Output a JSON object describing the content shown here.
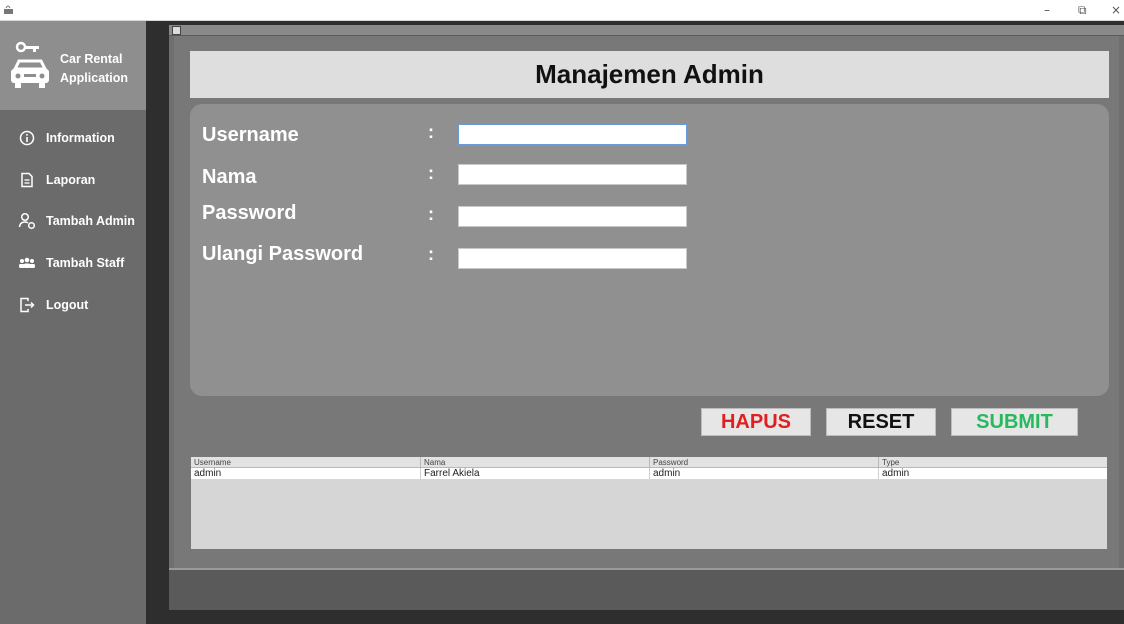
{
  "window": {
    "controls": [
      "–",
      "⧉",
      "×"
    ]
  },
  "sidebar": {
    "brand": {
      "line1": "Car Rental",
      "line2": "Application",
      "icon": "car-key-icon"
    },
    "items": [
      {
        "label": "Information",
        "icon": "info-icon"
      },
      {
        "label": "Laporan",
        "icon": "document-icon"
      },
      {
        "label": "Tambah Admin",
        "icon": "user-settings-icon"
      },
      {
        "label": "Tambah Staff",
        "icon": "group-icon"
      },
      {
        "label": "Logout",
        "icon": "logout-icon"
      }
    ]
  },
  "main": {
    "title": "Manajemen Admin",
    "form": {
      "fields": [
        {
          "label": "Username",
          "colon": ":",
          "value": ""
        },
        {
          "label": "Nama",
          "colon": ":",
          "value": ""
        },
        {
          "label": "Password",
          "colon": ":",
          "value": ""
        },
        {
          "label": "Ulangi Password",
          "colon": ":",
          "value": ""
        }
      ]
    },
    "buttons": {
      "hapus": {
        "label": "HAPUS",
        "color": "#e02020"
      },
      "reset": {
        "label": "RESET",
        "color": "#111111"
      },
      "submit": {
        "label": "SUBMIT",
        "color": "#28b860"
      }
    },
    "table": {
      "columns": [
        "Username",
        "Nama",
        "Password",
        "Type"
      ],
      "rows": [
        [
          "admin",
          "Farrel Akiela",
          "admin",
          "admin"
        ]
      ]
    }
  }
}
